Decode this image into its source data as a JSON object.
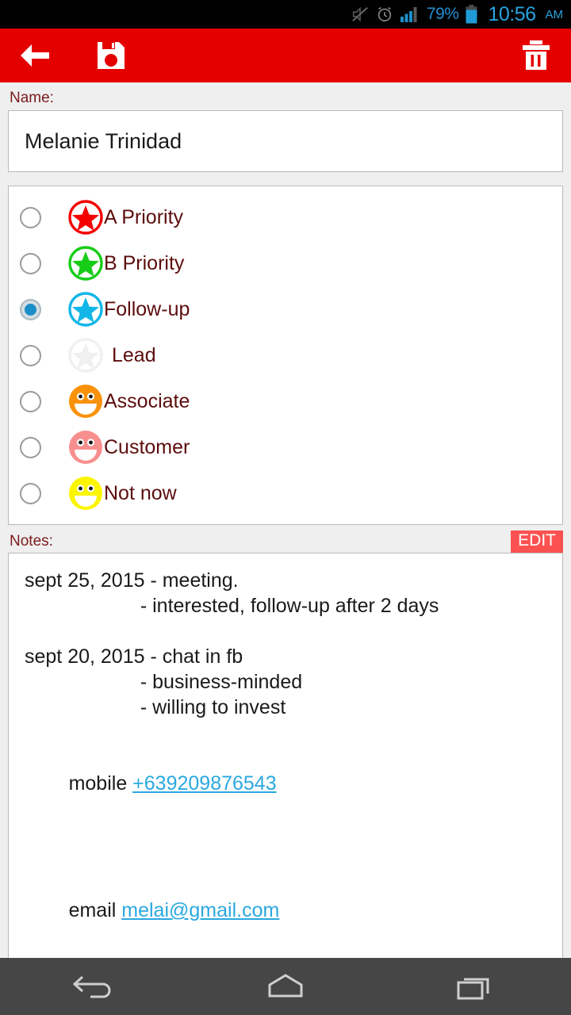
{
  "status_bar": {
    "icons": [
      "mute-icon",
      "alarm-icon",
      "signal-icon"
    ],
    "battery_percent": "79%",
    "battery_icon": "battery-icon",
    "time": "10:56",
    "meridiem": "AM",
    "accent_color": "#29a3e0"
  },
  "toolbar": {
    "background_color": "#e50000",
    "back_label": "back-arrow",
    "save_label": "save-floppy",
    "delete_label": "delete-trash"
  },
  "name_field": {
    "label": "Name:",
    "value": "Melanie Trinidad",
    "placeholder": "Name"
  },
  "priority": {
    "selected": "Follow-up",
    "options": [
      {
        "label": "A Priority",
        "icon": "star-icon",
        "color": "#f50000",
        "selected": false
      },
      {
        "label": "B Priority",
        "icon": "star-icon",
        "color": "#17cc17",
        "selected": false
      },
      {
        "label": "Follow-up",
        "icon": "star-icon",
        "color": "#12b6e8",
        "selected": true
      },
      {
        "label": "Lead",
        "icon": "star-icon",
        "color": "#f0f0f0",
        "selected": false
      },
      {
        "label": "Associate",
        "icon": "smiley-icon",
        "color": "#f9920a",
        "selected": false
      },
      {
        "label": "Customer",
        "icon": "smiley-icon",
        "color": "#f88f8f",
        "selected": false
      },
      {
        "label": "Not now",
        "icon": "smiley-icon",
        "color": "#fbf500",
        "selected": false
      }
    ]
  },
  "notes": {
    "label": "Notes:",
    "edit_label": "EDIT",
    "edit_color": "#fc5151",
    "lines": [
      "sept 25, 2015 - meeting.",
      "                     - interested, follow-up after 2 days",
      "",
      "sept 20, 2015 - chat in fb",
      "                     - business-minded",
      "                     - willing to invest",
      ""
    ],
    "mobile_label": "mobile ",
    "mobile_value": "+639209876543",
    "email_label": "email ",
    "email_value": "melai@gmail.com",
    "link_color": "#2aa8e0"
  },
  "nav_bar": {
    "background_color": "#464646",
    "back_label": "nav-back",
    "home_label": "nav-home",
    "recents_label": "nav-recents"
  }
}
